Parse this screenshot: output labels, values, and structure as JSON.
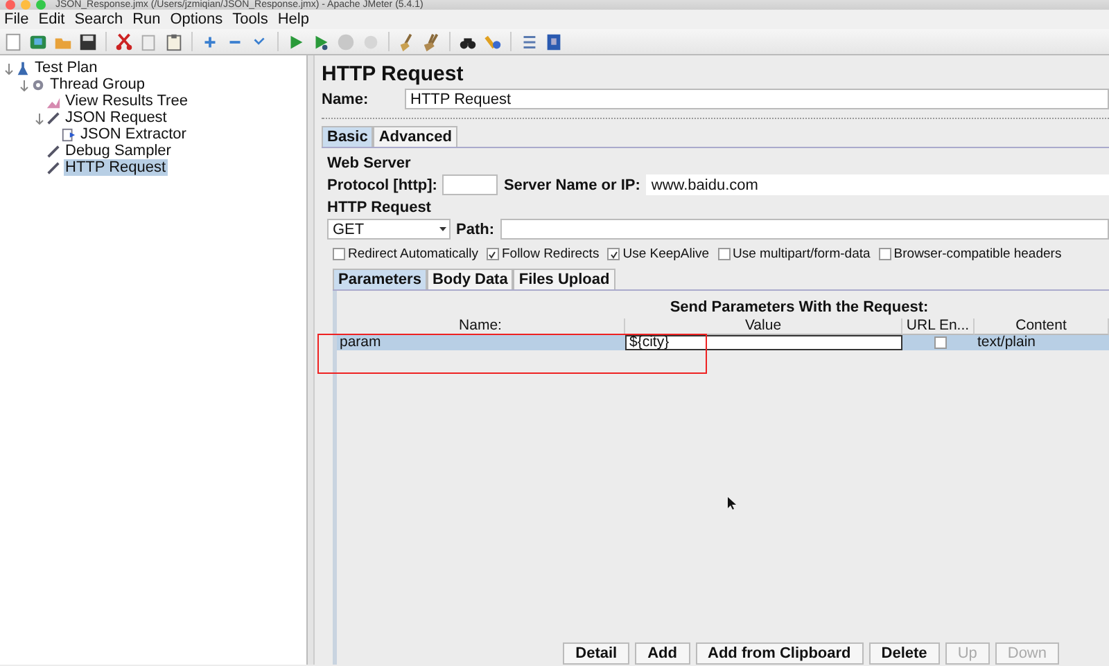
{
  "window": {
    "title": "JSON_Response.jmx (/Users/jzmiqian/JSON_Response.jmx) - Apache JMeter (5.4.1)"
  },
  "menu": [
    "File",
    "Edit",
    "Search",
    "Run",
    "Options",
    "Tools",
    "Help"
  ],
  "tree": [
    {
      "label": "Test Plan",
      "kind": "plan",
      "expanded": true,
      "selected": false,
      "children": [
        {
          "label": "Thread Group",
          "kind": "group",
          "expanded": true,
          "selected": false,
          "children": [
            {
              "label": "View Results Tree",
              "kind": "listener",
              "selected": false
            },
            {
              "label": "JSON Request",
              "kind": "sampler",
              "expanded": true,
              "selected": false,
              "children": [
                {
                  "label": "JSON Extractor",
                  "kind": "extractor",
                  "selected": false
                }
              ]
            },
            {
              "label": "Debug Sampler",
              "kind": "sampler",
              "selected": false
            },
            {
              "label": "HTTP Request",
              "kind": "sampler",
              "selected": true
            }
          ]
        }
      ]
    }
  ],
  "panel": {
    "title": "HTTP Request",
    "name_label": "Name:",
    "name_value": "HTTP Request"
  },
  "tabs": [
    {
      "label": "Basic",
      "selected": true
    },
    {
      "label": "Advanced",
      "selected": false
    }
  ],
  "web_server": {
    "heading": "Web Server",
    "protocol_label": "Protocol [http]:",
    "server_label": "Server Name or IP:",
    "server_value": "www.baidu.com"
  },
  "http_request": {
    "heading": "HTTP Request",
    "method": "GET",
    "path_label": "Path:"
  },
  "options": [
    {
      "label": "Redirect Automatically",
      "checked": false
    },
    {
      "label": "Follow Redirects",
      "checked": true
    },
    {
      "label": "Use KeepAlive",
      "checked": true
    },
    {
      "label": "Use multipart/form-data",
      "checked": false
    },
    {
      "label": "Browser-compatible headers",
      "checked": false
    }
  ],
  "sub_tabs": [
    {
      "label": "Parameters",
      "selected": true
    },
    {
      "label": "Body Data",
      "selected": false
    },
    {
      "label": "Files Upload",
      "selected": false
    }
  ],
  "table": {
    "caption": "Send Parameters With the Request:",
    "columns": [
      "Name:",
      "Value",
      "URL En...",
      "Content"
    ],
    "rows": [
      {
        "name": "param",
        "value": "${city}",
        "url_encode": false,
        "content_type": "text/plain",
        "selected": true,
        "editing": true
      }
    ]
  },
  "buttons": [
    {
      "label": "Detail",
      "disabled": false
    },
    {
      "label": "Add",
      "disabled": false
    },
    {
      "label": "Add from Clipboard",
      "disabled": false
    },
    {
      "label": "Delete",
      "disabled": false
    },
    {
      "label": "Up",
      "disabled": true
    },
    {
      "label": "Down",
      "disabled": true
    }
  ]
}
